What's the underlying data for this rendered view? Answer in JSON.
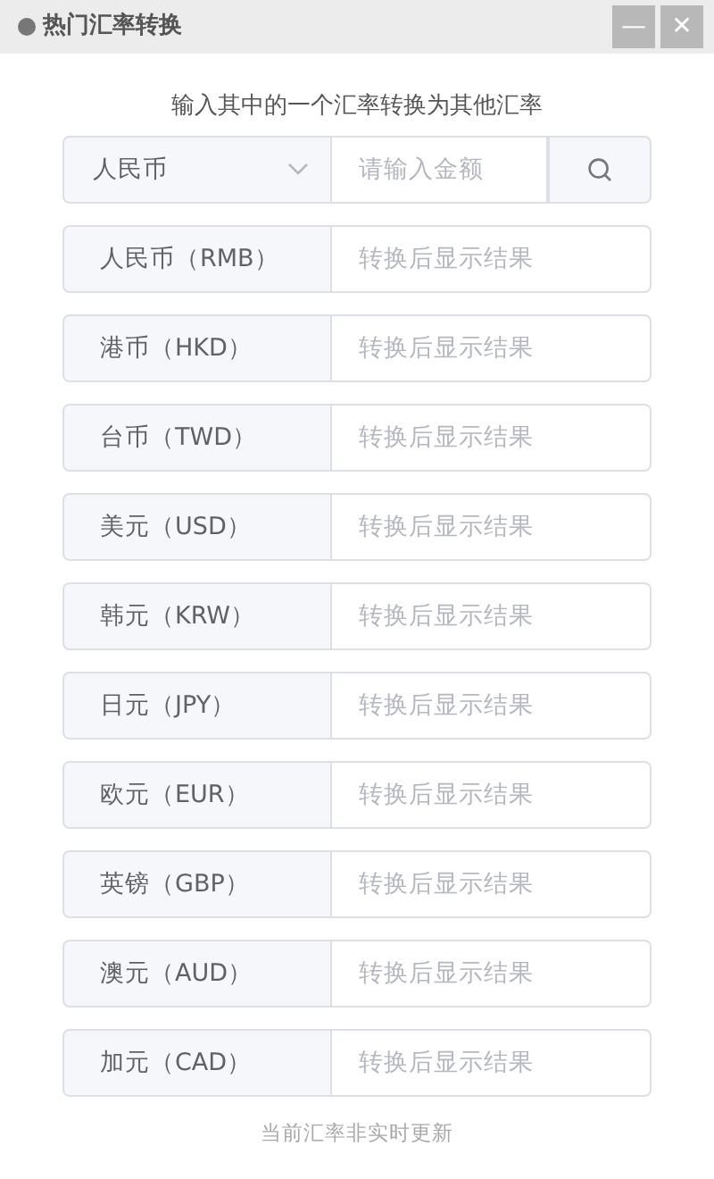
{
  "window": {
    "title": "热门汇率转换",
    "buttons": [
      "—",
      "✕"
    ]
  },
  "subtitle": "输入其中的一个汇率转换为其他汇率",
  "search": {
    "currency": "人民币",
    "placeholder": "请输入金额"
  },
  "rates": [
    {
      "label": "人民币（RMB）",
      "placeholder": "转换后显示结果"
    },
    {
      "label": "港币（HKD）",
      "placeholder": "转换后显示结果"
    },
    {
      "label": "台币（TWD）",
      "placeholder": "转换后显示结果"
    },
    {
      "label": "美元（USD）",
      "placeholder": "转换后显示结果"
    },
    {
      "label": "韩元（KRW）",
      "placeholder": "转换后显示结果"
    },
    {
      "label": "日元（JPY）",
      "placeholder": "转换后显示结果"
    },
    {
      "label": "欧元（EUR）",
      "placeholder": "转换后显示结果"
    },
    {
      "label": "英镑（GBP）",
      "placeholder": "转换后显示结果"
    },
    {
      "label": "澳元（AUD）",
      "placeholder": "转换后显示结果"
    },
    {
      "label": "加元（CAD）",
      "placeholder": "转换后显示结果"
    }
  ],
  "footer": "当前汇率非实时更新"
}
